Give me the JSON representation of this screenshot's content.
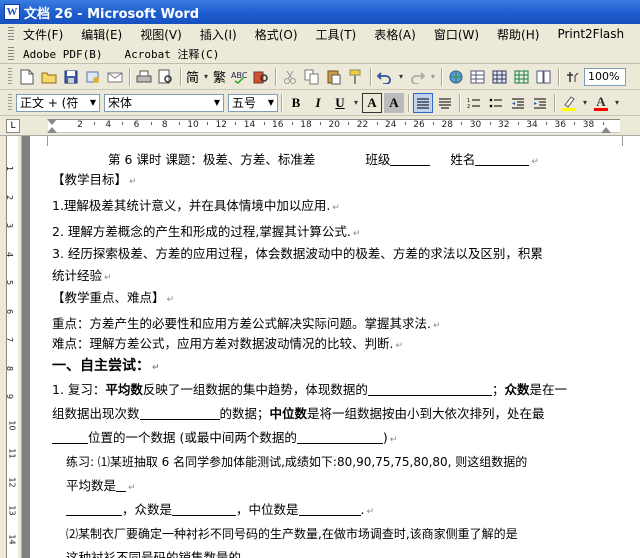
{
  "window": {
    "title": "文档 26 - Microsoft Word",
    "icon": "W"
  },
  "menu": {
    "row1": [
      "文件(F)",
      "编辑(E)",
      "视图(V)",
      "插入(I)",
      "格式(O)",
      "工具(T)",
      "表格(A)",
      "窗口(W)",
      "帮助(H)",
      "Print2Flash"
    ],
    "row2": [
      "Adobe PDF(B)",
      "Acrobat 注释(C)"
    ]
  },
  "toolbar": {
    "zoom": "100%",
    "trad_simp": [
      "简",
      "繁"
    ],
    "style": "正文 + (符",
    "font": "宋体",
    "size": "五号",
    "bold": "B",
    "italic": "I",
    "underline": "U",
    "charborder": "A",
    "charshade": "A",
    "fontcolor": "A"
  },
  "ruler": {
    "ticks": [
      "2",
      "4",
      "6",
      "8",
      "10",
      "12",
      "14",
      "16",
      "18",
      "20",
      "22",
      "24",
      "26",
      "28",
      "30",
      "32",
      "34",
      "36",
      "38"
    ]
  },
  "vruler": {
    "ticks": [
      "1",
      "2",
      "3",
      "4",
      "5",
      "6",
      "7",
      "8",
      "9",
      "10",
      "11",
      "12",
      "13",
      "14"
    ]
  },
  "doc": {
    "l1_a": "第 6 课时 课题：极差、方差、标准差",
    "l1_b": "班级",
    "l1_c": "姓名",
    "l2": "【教学目标】",
    "l3": "1.理解极差其统计意义，并在具体情境中加以应用.",
    "l4": "2. 理解方差概念的产生和形成的过程,掌握其计算公式.",
    "l5": "3. 经历探索极差、方差的应用过程，体会数据波动中的极差、方差的求法以及区别，积累",
    "l6": "统计经验",
    "l7": "【教学重点、难点】",
    "l8": "重点：方差产生的必要性和应用方差公式解决实际问题。掌握其求法.",
    "l9": "难点：理解方差公式，应用方差对数据波动情况的比较、判断.",
    "l10": "一、自主尝试：",
    "l11_a": "1. 复习：",
    "l11_b": "平均数",
    "l11_c": "反映了一组数据的集中趋势，体现数据的",
    "l11_d": "；",
    "l11_e": "众数",
    "l11_f": "是在一",
    "l12_a": "组数据出现次数",
    "l12_b": "的数据；",
    "l12_c": "中位数",
    "l12_d": "是将一组数据按由小到大依次排列，处在最",
    "l13_a": "位置的一个数据 (或最中间两个数据的",
    "l13_b": ")",
    "l14": "练习: ⑴某班抽取 6 名同学参加体能测试,成绩如下:80,90,75,75,80,80, 则这组数据的",
    "l15": "平均数是",
    "l16_a": "，众数是",
    "l16_b": "，中位数是",
    "l16_c": ".",
    "l17": "⑵某制衣厂要确定一种衬衫不同号码的生产数量,在做市场调查时,该商家侧重了解的是",
    "l18": "这种衬衫不同号码的销售数量的"
  }
}
